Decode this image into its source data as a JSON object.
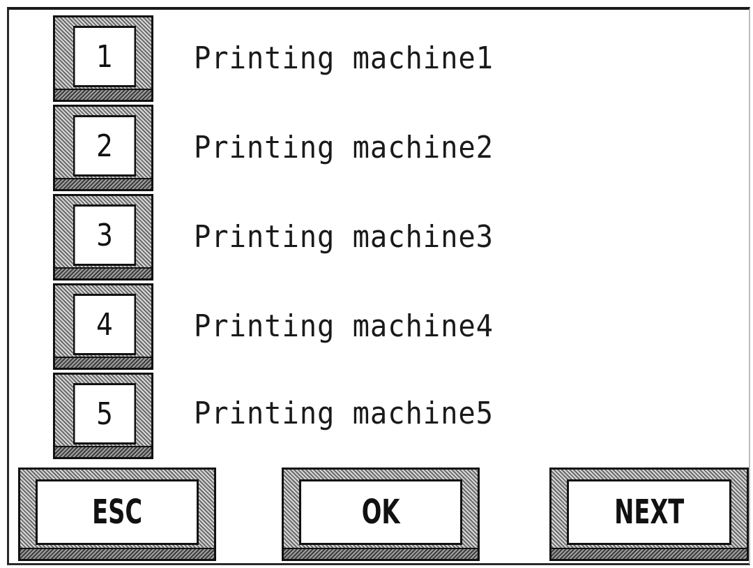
{
  "machines": {
    "items": [
      {
        "number": "1",
        "label": "Printing machine1"
      },
      {
        "number": "2",
        "label": "Printing machine2"
      },
      {
        "number": "3",
        "label": "Printing machine3"
      },
      {
        "number": "4",
        "label": "Printing machine4"
      },
      {
        "number": "5",
        "label": "Printing machine5"
      }
    ]
  },
  "actions": {
    "esc_label": "ESC",
    "ok_label": "OK",
    "next_label": "NEXT"
  }
}
